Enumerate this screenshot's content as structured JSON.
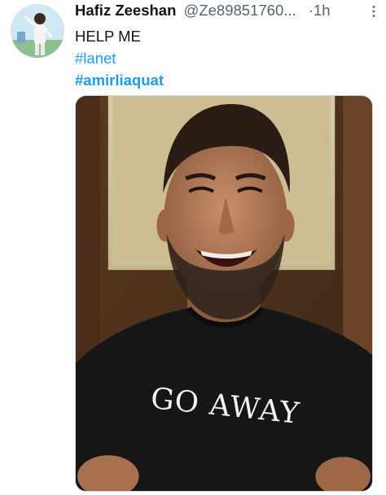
{
  "tweet": {
    "author": {
      "display_name": "Hafiz Zeeshan",
      "handle": "@Ze89851760...",
      "avatar_icon": "profile-avatar"
    },
    "separator": "·",
    "time": "1h",
    "more_icon": "more-vertical-icon",
    "lines": [
      "HELP ME",
      "#lanet",
      "#amirliaquat"
    ],
    "media": {
      "kind": "photo",
      "shirt_text": "GO AWAY"
    }
  },
  "colors": {
    "text_primary": "#0f1419",
    "text_secondary": "#536471",
    "link": "#1d9bf0",
    "media_border": "#cfd9de"
  }
}
